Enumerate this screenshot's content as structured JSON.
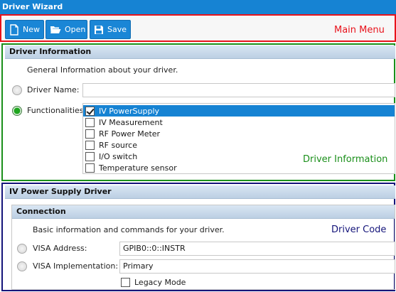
{
  "window": {
    "title": "Driver Wizard"
  },
  "toolbar": {
    "new_label": "New",
    "open_label": "Open",
    "save_label": "Save",
    "annotation": "Main Menu"
  },
  "driver_information": {
    "header": "Driver Information",
    "description": "General Information about your driver.",
    "driver_name_label": "Driver Name:",
    "driver_name_value": "",
    "functionalities_label": "Functionalities:",
    "functionalities": [
      {
        "label": "IV PowerSupply",
        "checked": true,
        "selected": true
      },
      {
        "label": "IV Measurement",
        "checked": false,
        "selected": false
      },
      {
        "label": "RF Power Meter",
        "checked": false,
        "selected": false
      },
      {
        "label": "RF source",
        "checked": false,
        "selected": false
      },
      {
        "label": "I/O switch",
        "checked": false,
        "selected": false
      },
      {
        "label": "Temperature sensor",
        "checked": false,
        "selected": false
      }
    ],
    "annotation": "Driver Information"
  },
  "driver_code": {
    "header": "IV Power Supply Driver",
    "connection_header": "Connection",
    "description": "Basic information and commands for your driver.",
    "visa_address_label": "VISA Address:",
    "visa_address_value": "GPIB0::0::INSTR",
    "visa_impl_label": "VISA Implementation:",
    "visa_impl_value": "Primary",
    "legacy_mode_label": "Legacy Mode",
    "annotation": "Driver Code"
  },
  "colors": {
    "accent": "#1683d3",
    "main_menu_border": "#e8121b",
    "driver_info_border": "#1a8f1a",
    "driver_code_border": "#14147a"
  }
}
